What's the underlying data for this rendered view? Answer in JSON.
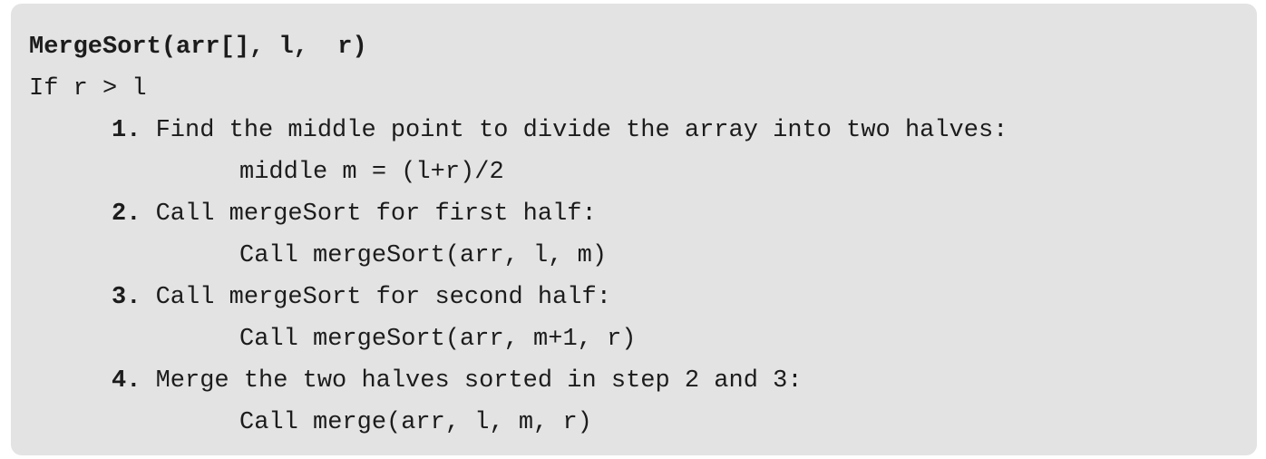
{
  "code": {
    "signature": "MergeSort(arr[], l,  r)",
    "condition": "If r > l",
    "steps": [
      {
        "number": "1.",
        "text": " Find the middle point to divide the array into two halves:",
        "detail": "middle m = (l+r)/2"
      },
      {
        "number": "2.",
        "text": " Call mergeSort for first half:",
        "detail": "Call mergeSort(arr, l, m)"
      },
      {
        "number": "3.",
        "text": " Call mergeSort for second half:",
        "detail": "Call mergeSort(arr, m+1, r)"
      },
      {
        "number": "4.",
        "text": " Merge the two halves sorted in step 2 and 3:",
        "detail": "Call merge(arr, l, m, r)"
      }
    ]
  }
}
